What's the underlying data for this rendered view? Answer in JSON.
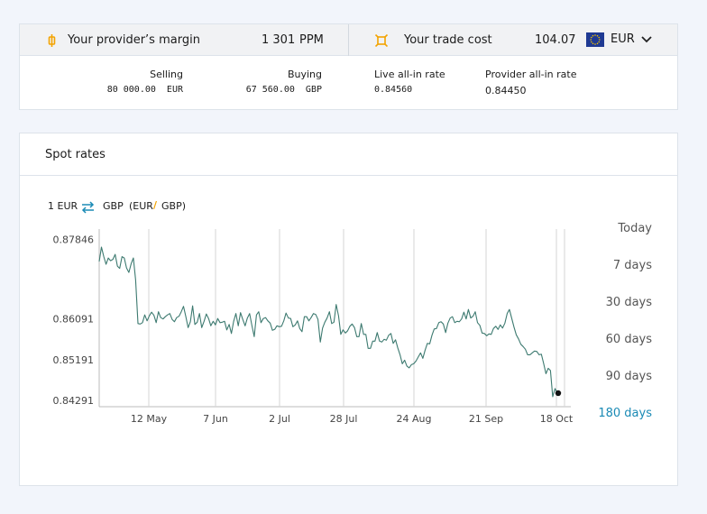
{
  "margin": {
    "label": "Your provider’s margin",
    "value": "1 301",
    "unit": "PPM"
  },
  "trade_cost": {
    "label": "Your trade cost",
    "value": "104.07",
    "currency": "EUR"
  },
  "details": {
    "selling_label": "Selling",
    "selling_value": "80 000.00  EUR",
    "buying_label": "Buying",
    "buying_value": "67 560.00  GBP",
    "live_label": "Live all-in rate",
    "live_value": "0.84560",
    "provider_label": "Provider all-in rate",
    "provider_value": "0.84450"
  },
  "spot": {
    "title": "Spot rates",
    "base": "1 EUR",
    "quote": "GBP",
    "pair_open": "(EUR",
    "pair_slash": "/",
    "pair_close": "GBP)"
  },
  "ranges": [
    "Today",
    "7 days",
    "30 days",
    "60 days",
    "90 days",
    "180 days"
  ],
  "active_range": "180 days",
  "colors": {
    "line": "#3d7a70",
    "accent": "#1a8ab5",
    "icon": "#f3a300"
  },
  "chart_data": {
    "type": "line",
    "title": "",
    "xlabel": "",
    "ylabel": "",
    "yticks": [
      "0.87846",
      "0.86091",
      "0.85191",
      "0.84291"
    ],
    "xticks": [
      "12 May",
      "7 Jun",
      "2 Jul",
      "28 Jul",
      "24 Aug",
      "21 Sep",
      "18 Oct"
    ],
    "ylim": [
      0.8415,
      0.88
    ],
    "grid": "vertical",
    "series": [
      {
        "values": [
          0.8736,
          0.8768,
          0.8747,
          0.873,
          0.8744,
          0.8738,
          0.8741,
          0.8752,
          0.8726,
          0.8721,
          0.8747,
          0.8744,
          0.8722,
          0.8712,
          0.8731,
          0.8744,
          0.8695,
          0.8599,
          0.8598,
          0.8601,
          0.8618,
          0.8605,
          0.8616,
          0.8624,
          0.8617,
          0.8601,
          0.8625,
          0.8612,
          0.8609,
          0.8614,
          0.8618,
          0.8621,
          0.8608,
          0.8603,
          0.8612,
          0.8615,
          0.8625,
          0.8637,
          0.8615,
          0.859,
          0.8603,
          0.8638,
          0.8597,
          0.8602,
          0.8621,
          0.859,
          0.8604,
          0.862,
          0.861,
          0.8594,
          0.8604,
          0.8596,
          0.861,
          0.8601,
          0.8602,
          0.8604,
          0.8585,
          0.8597,
          0.8577,
          0.8604,
          0.8621,
          0.8594,
          0.8623,
          0.8608,
          0.8594,
          0.8611,
          0.8621,
          0.8595,
          0.857,
          0.8618,
          0.8625,
          0.8601,
          0.861,
          0.8612,
          0.8605,
          0.86,
          0.8584,
          0.8586,
          0.8594,
          0.8592,
          0.8593,
          0.8605,
          0.8622,
          0.8611,
          0.861,
          0.8592,
          0.8596,
          0.8605,
          0.8588,
          0.8581,
          0.8614,
          0.8614,
          0.8605,
          0.8612,
          0.8621,
          0.8619,
          0.8608,
          0.8558,
          0.8589,
          0.8602,
          0.8611,
          0.8625,
          0.8599,
          0.8602,
          0.8641,
          0.8616,
          0.8575,
          0.8585,
          0.8578,
          0.8583,
          0.8593,
          0.8598,
          0.859,
          0.857,
          0.857,
          0.8599,
          0.8575,
          0.8575,
          0.8544,
          0.8544,
          0.856,
          0.856,
          0.8579,
          0.856,
          0.8558,
          0.8564,
          0.8562,
          0.8573,
          0.8577,
          0.8555,
          0.8563,
          0.8545,
          0.853,
          0.851,
          0.8518,
          0.8505,
          0.8501,
          0.8508,
          0.851,
          0.8516,
          0.8525,
          0.8534,
          0.8522,
          0.854,
          0.8555,
          0.8554,
          0.8573,
          0.8587,
          0.8588,
          0.8601,
          0.8603,
          0.8598,
          0.8579,
          0.86,
          0.8611,
          0.8614,
          0.8601,
          0.8604,
          0.8603,
          0.8609,
          0.8624,
          0.8609,
          0.863,
          0.8611,
          0.8615,
          0.8625,
          0.8601,
          0.8595,
          0.8578,
          0.8577,
          0.8572,
          0.8576,
          0.8575,
          0.8588,
          0.8593,
          0.8586,
          0.8596,
          0.8589,
          0.86,
          0.8621,
          0.863,
          0.861,
          0.8591,
          0.8574,
          0.8565,
          0.8553,
          0.8548,
          0.8542,
          0.853,
          0.853,
          0.8534,
          0.8538,
          0.8537,
          0.853,
          0.8531,
          0.8511,
          0.8488,
          0.85,
          0.8495,
          0.8437,
          0.8455,
          0.8445
        ]
      }
    ],
    "marker_value": 0.8445
  }
}
